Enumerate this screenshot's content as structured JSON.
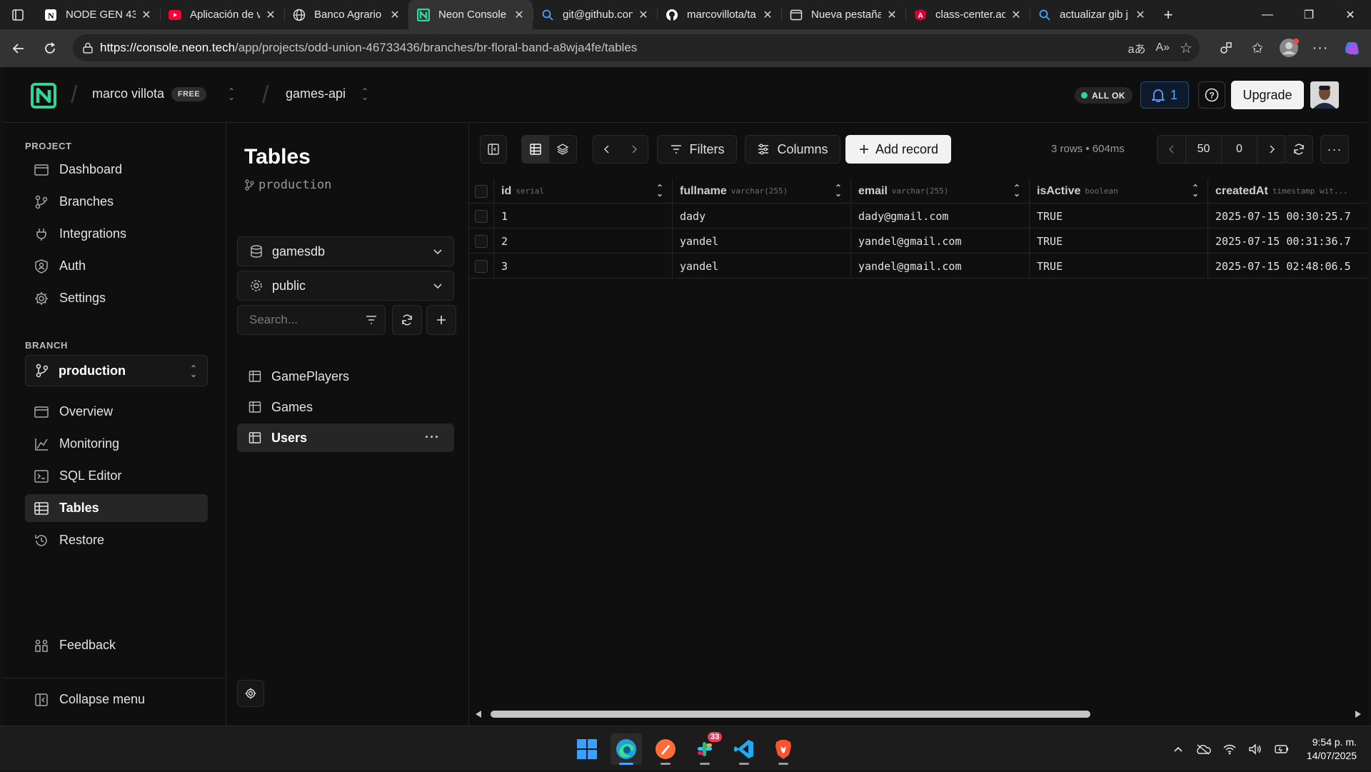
{
  "browser": {
    "tabs": [
      {
        "title": "NODE GEN 43",
        "icon": "notion-icon",
        "active": false
      },
      {
        "title": "Aplicación de v",
        "icon": "youtube-icon",
        "active": false
      },
      {
        "title": "Banco Agrario",
        "icon": "globe-icon",
        "active": false
      },
      {
        "title": "Neon Console",
        "icon": "neon-icon",
        "active": true
      },
      {
        "title": "git@github.con",
        "icon": "search-icon",
        "active": false
      },
      {
        "title": "marcovillota/ta",
        "icon": "github-icon",
        "active": false
      },
      {
        "title": "Nueva pestaña",
        "icon": "newtab-icon",
        "active": false
      },
      {
        "title": "class-center.ac",
        "icon": "angular-icon",
        "active": false
      },
      {
        "title": "actualizar gib j",
        "icon": "search-icon",
        "active": false
      }
    ],
    "url_host": "https://console.neon.tech",
    "url_path": "/app/projects/odd-union-46733436/branches/br-floral-band-a8wja4fe/tables"
  },
  "header": {
    "org_name": "marco villota",
    "plan_badge": "FREE",
    "project_name": "games-api",
    "status": "ALL OK",
    "notifications_count": "1",
    "upgrade_label": "Upgrade"
  },
  "sidebar": {
    "project_label": "PROJECT",
    "project_items": [
      {
        "label": "Dashboard",
        "icon": "dashboard-icon"
      },
      {
        "label": "Branches",
        "icon": "branch-icon"
      },
      {
        "label": "Integrations",
        "icon": "integrations-icon"
      },
      {
        "label": "Auth",
        "icon": "auth-icon"
      },
      {
        "label": "Settings",
        "icon": "gear-icon"
      }
    ],
    "branch_label": "BRANCH",
    "branch_name": "production",
    "branch_items": [
      {
        "label": "Overview",
        "icon": "overview-icon"
      },
      {
        "label": "Monitoring",
        "icon": "monitoring-icon"
      },
      {
        "label": "SQL Editor",
        "icon": "sql-editor-icon"
      },
      {
        "label": "Tables",
        "icon": "tables-icon",
        "active": true
      },
      {
        "label": "Restore",
        "icon": "restore-icon"
      }
    ],
    "feedback_label": "Feedback",
    "collapse_label": "Collapse menu"
  },
  "tables_panel": {
    "title": "Tables",
    "branch": "production",
    "database": "gamesdb",
    "schema": "public",
    "search_placeholder": "Search...",
    "tables": [
      {
        "name": "GamePlayers",
        "active": false
      },
      {
        "name": "Games",
        "active": false
      },
      {
        "name": "Users",
        "active": true
      }
    ]
  },
  "toolbar": {
    "filters_label": "Filters",
    "columns_label": "Columns",
    "add_record_label": "Add record",
    "row_info": "3 rows • 604ms",
    "page_size": "50",
    "offset": "0"
  },
  "grid": {
    "columns": [
      {
        "name": "id",
        "type": "serial"
      },
      {
        "name": "fullname",
        "type": "varchar(255)"
      },
      {
        "name": "email",
        "type": "varchar(255)"
      },
      {
        "name": "isActive",
        "type": "boolean"
      },
      {
        "name": "createdAt",
        "type": "timestamp wit..."
      }
    ],
    "rows": [
      [
        "1",
        "dady",
        "dady@gmail.com",
        "TRUE",
        "2025-07-15 00:30:25.7"
      ],
      [
        "2",
        "yandel",
        "yandel@gmail.com",
        "TRUE",
        "2025-07-15 00:31:36.7"
      ],
      [
        "3",
        "yandel",
        "yandel@gmail.com",
        "TRUE",
        "2025-07-15 02:48:06.5"
      ]
    ]
  },
  "taskbar": {
    "apps": [
      "windows-start-icon",
      "edge-icon",
      "postman-icon",
      "slack-icon",
      "vscode-icon",
      "brave-icon"
    ],
    "slack_badge": "33",
    "time": "9:54 p. m.",
    "date": "14/07/2025"
  },
  "colors": {
    "neon_accent": "#34d399",
    "background": "#0f0f0f",
    "notification_blue": "#5aa2ff"
  }
}
